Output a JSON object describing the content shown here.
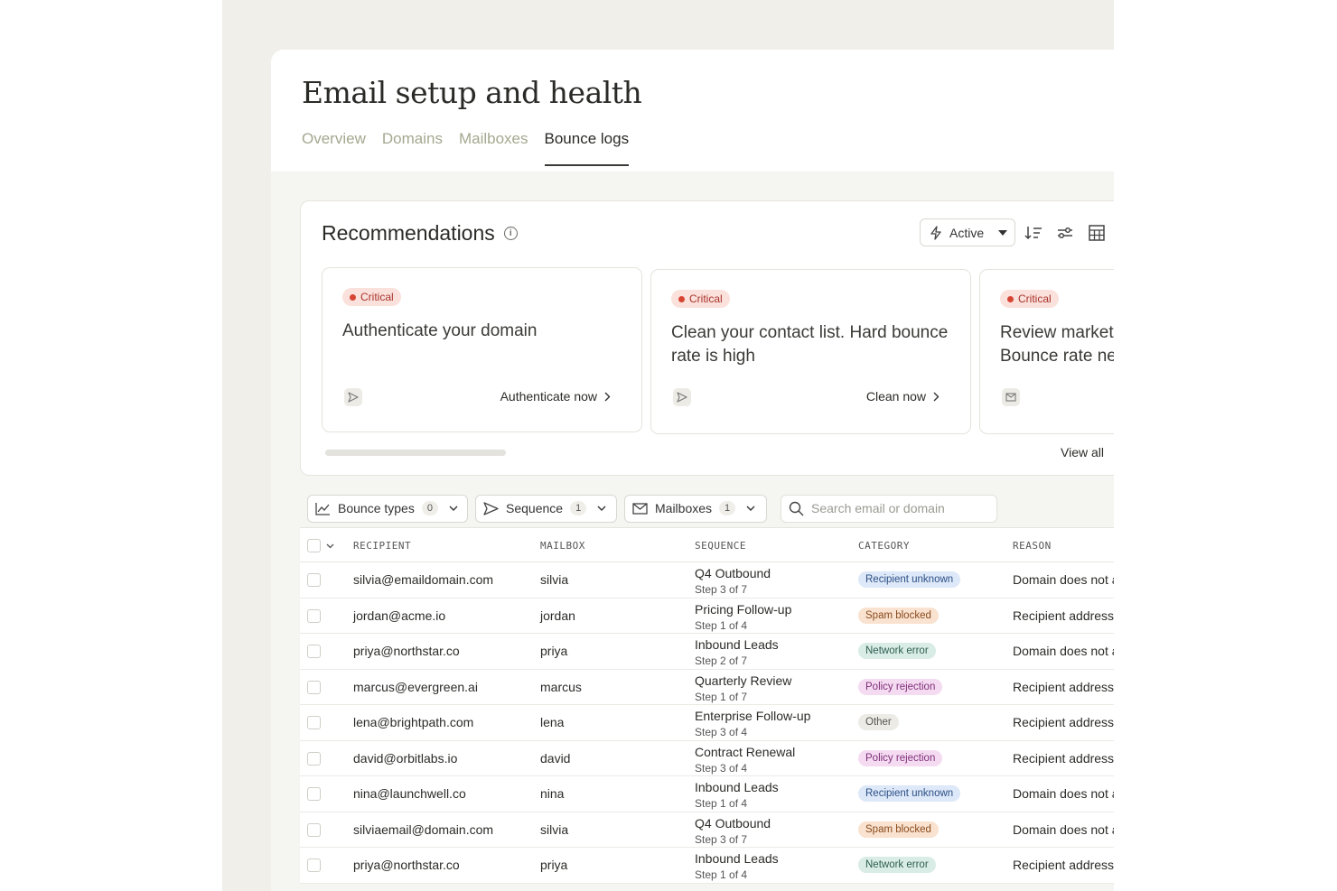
{
  "page": {
    "title": "Email setup and health",
    "tabs": [
      {
        "label": "Overview",
        "active": false
      },
      {
        "label": "Domains",
        "active": false
      },
      {
        "label": "Mailboxes",
        "active": false
      },
      {
        "label": "Bounce logs",
        "active": true
      }
    ]
  },
  "recommendations": {
    "title": "Recommendations",
    "filter_label": "Active",
    "view_all": "View all",
    "cards": [
      {
        "badge": "Critical",
        "title": "Authenticate your domain",
        "icon": "send-icon",
        "action": "Authenticate now"
      },
      {
        "badge": "Critical",
        "title": "Clean your contact list. Hard bounce rate is high",
        "icon": "send-icon",
        "action": "Clean now"
      },
      {
        "badge": "Critical",
        "title": "Review market Bounce rate ne",
        "icon": "mail-icon",
        "action": ""
      }
    ]
  },
  "filters": {
    "bounce_types": {
      "label": "Bounce types",
      "count": "0"
    },
    "sequence": {
      "label": "Sequence",
      "count": "1"
    },
    "mailboxes": {
      "label": "Mailboxes",
      "count": "1"
    },
    "search_placeholder": "Search email or domain"
  },
  "table": {
    "headers": {
      "recipient": "RECIPIENT",
      "mailbox": "MAILBOX",
      "sequence": "SEQUENCE",
      "category": "CATEGORY",
      "reason": "REASON"
    },
    "rows": [
      {
        "recipient": "silvia@emaildomain.com",
        "mailbox": "silvia",
        "sequence": "Q4 Outbound",
        "step": "Step 3 of 7",
        "category": "Recipient unknown",
        "reason": "Domain does not a"
      },
      {
        "recipient": "jordan@acme.io",
        "mailbox": "jordan",
        "sequence": "Pricing Follow-up",
        "step": "Step 1 of 4",
        "category": "Spam blocked",
        "reason": "Recipient address"
      },
      {
        "recipient": "priya@northstar.co",
        "mailbox": "priya",
        "sequence": "Inbound Leads",
        "step": "Step 2 of 7",
        "category": "Network error",
        "reason": "Domain does not a"
      },
      {
        "recipient": "marcus@evergreen.ai",
        "mailbox": "marcus",
        "sequence": "Quarterly Review",
        "step": "Step 1 of 7",
        "category": "Policy rejection",
        "reason": "Recipient address"
      },
      {
        "recipient": "lena@brightpath.com",
        "mailbox": "lena",
        "sequence": "Enterprise Follow-up",
        "step": "Step 3 of 4",
        "category": "Other",
        "reason": "Recipient address"
      },
      {
        "recipient": "david@orbitlabs.io",
        "mailbox": "david",
        "sequence": "Contract Renewal",
        "step": "Step 3 of 4",
        "category": "Policy rejection",
        "reason": "Recipient address"
      },
      {
        "recipient": "nina@launchwell.co",
        "mailbox": "nina",
        "sequence": "Inbound Leads",
        "step": "Step 1 of 4",
        "category": "Recipient unknown",
        "reason": "Domain does not a"
      },
      {
        "recipient": "silviaemail@domain.com",
        "mailbox": "silvia",
        "sequence": "Q4 Outbound",
        "step": "Step 3 of 7",
        "category": "Spam blocked",
        "reason": "Domain does not a"
      },
      {
        "recipient": "priya@northstar.co",
        "mailbox": "priya",
        "sequence": "Inbound Leads",
        "step": "Step 1 of 4",
        "category": "Network error",
        "reason": "Recipient address"
      }
    ]
  },
  "colors": {
    "critical_bg": "#fbe1dc",
    "critical_text": "#a8332a",
    "recipient_unknown_bg": "#dde8f8",
    "spam_blocked_bg": "#f9e2cf",
    "network_error_bg": "#d9ece6",
    "policy_rejection_bg": "#f5dbf2",
    "other_bg": "#ecebe6"
  }
}
